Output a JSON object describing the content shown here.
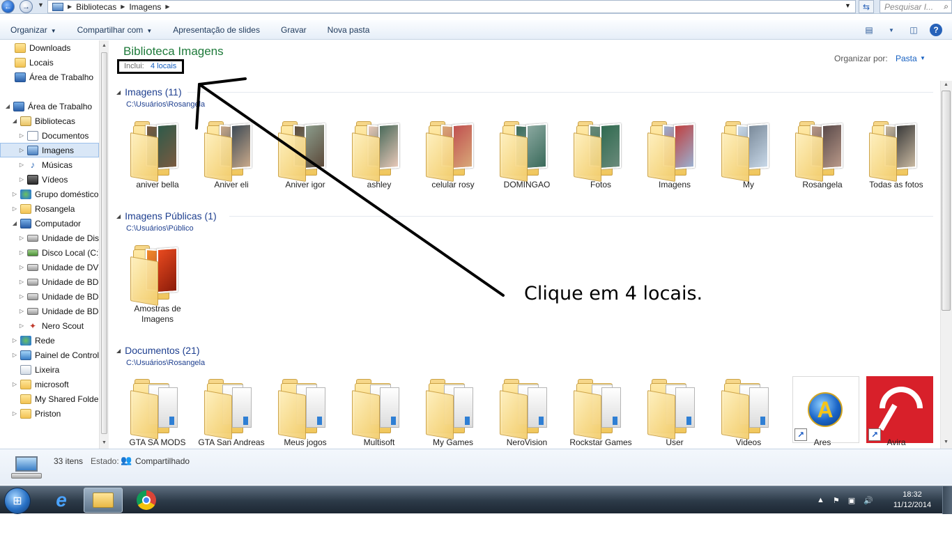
{
  "address_bar": {
    "breadcrumbs": [
      "Bibliotecas",
      "Imagens"
    ],
    "search_placeholder": "Pesquisar I..."
  },
  "toolbar": {
    "organize": "Organizar",
    "share": "Compartilhar com",
    "slideshow": "Apresentação de slides",
    "burn": "Gravar",
    "new_folder": "Nova pasta"
  },
  "sidebar": {
    "items": [
      {
        "label": "Downloads",
        "icon": "downloads-folder-icon"
      },
      {
        "label": "Locais",
        "icon": "recent-places-icon"
      },
      {
        "label": "Área de Trabalho",
        "icon": "desktop-icon"
      },
      {
        "label": "Área de Trabalho",
        "icon": "desktop-icon"
      },
      {
        "label": "Bibliotecas",
        "icon": "libraries-icon"
      },
      {
        "label": "Documentos",
        "icon": "documents-icon"
      },
      {
        "label": "Imagens",
        "icon": "pictures-icon"
      },
      {
        "label": "Músicas",
        "icon": "music-icon"
      },
      {
        "label": "Vídeos",
        "icon": "videos-icon"
      },
      {
        "label": "Grupo doméstico",
        "icon": "homegroup-icon"
      },
      {
        "label": "Rosangela",
        "icon": "user-folder-icon"
      },
      {
        "label": "Computador",
        "icon": "computer-icon"
      },
      {
        "label": "Unidade de Disc",
        "icon": "drive-icon"
      },
      {
        "label": "Disco Local (C:)",
        "icon": "local-disk-icon"
      },
      {
        "label": "Unidade de DVD",
        "icon": "dvd-drive-icon"
      },
      {
        "label": "Unidade de BD-",
        "icon": "bd-drive-icon"
      },
      {
        "label": "Unidade de BD-",
        "icon": "bd-drive-icon"
      },
      {
        "label": "Unidade de BD-",
        "icon": "bd-drive-icon"
      },
      {
        "label": "Nero Scout",
        "icon": "nero-scout-icon"
      },
      {
        "label": "Rede",
        "icon": "network-icon"
      },
      {
        "label": "Painel de Control",
        "icon": "control-panel-icon"
      },
      {
        "label": "Lixeira",
        "icon": "recycle-bin-icon"
      },
      {
        "label": "microsoft",
        "icon": "folder-icon"
      },
      {
        "label": "My Shared Folder",
        "icon": "folder-icon"
      },
      {
        "label": "Priston",
        "icon": "folder-icon"
      }
    ]
  },
  "library": {
    "title": "Biblioteca Imagens",
    "includes_label": "Inclui:",
    "includes_link": "4 locais",
    "arrange_label": "Organizar por:",
    "arrange_value": "Pasta"
  },
  "groups": [
    {
      "title": "Imagens (11)",
      "path": "C:\\Usuários\\Rosangela",
      "items": [
        "aniver bella",
        "Aniver eli",
        "Aniver igor",
        "ashley",
        "celular rosy",
        "DOMINGAO",
        "Fotos",
        "Imagens",
        "My",
        "Rosangela",
        "Todas as fotos"
      ]
    },
    {
      "title": "Imagens Públicas (1)",
      "path": "C:\\Usuários\\Público",
      "items": [
        "Amostras de",
        "Imagens"
      ]
    },
    {
      "title": "Documentos (21)",
      "path": "C:\\Usuários\\Rosangela",
      "items": [
        "GTA SA MODS",
        "GTA San Andreas",
        "Meus jogos",
        "Multisoft",
        "My Games",
        "NeroVision",
        "Rockstar Games",
        "User",
        "Videos",
        "Ares",
        "Avira"
      ]
    }
  ],
  "annotation": {
    "text": "Clique em 4 locais."
  },
  "details": {
    "item_count": "33 itens",
    "state_label": "Estado:",
    "state_value": "Compartilhado"
  },
  "taskbar": {
    "time": "18:32",
    "date": "11/12/2014"
  }
}
